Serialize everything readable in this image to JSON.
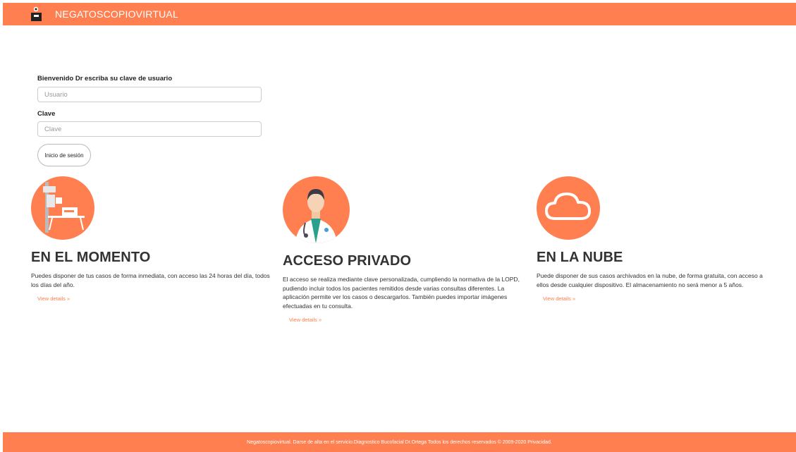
{
  "header": {
    "brand": "NEGATOSCOPIOVIRTUAL"
  },
  "login": {
    "welcome_label": "Bienvenido Dr escriba su clave de usuario",
    "user_placeholder": "Usuario",
    "password_label": "Clave",
    "password_placeholder": "Clave",
    "submit_label": "Inicio de sesión"
  },
  "features": [
    {
      "title": "EN EL MOMENTO",
      "text": "Puedes disponer de tus casos de forma inmediata, con acceso las 24 horas del día, todos los días del año.",
      "link": "View details »"
    },
    {
      "title": "ACCESO PRIVADO",
      "text": "El acceso se realiza mediante clave personalizada, cumpliendo la normativa de la LOPD, pudiendo incluir todos los pacientes remitidos desde varias consultas diferentes. La aplicación permite ver los casos o descargarlos. También puedes importar imágenes efectuadas en tu consulta.",
      "link": "View details »"
    },
    {
      "title": "EN LA NUBE",
      "text": "Puede disponer de sus casos archivados en la nube, de forma gratuita, con acceso a ellos desde cualquier dispositivo. El almacenamiento no será menor a 5 años.",
      "link": "View details »"
    }
  ],
  "footer": {
    "text": "Negatoscopiovirtual. Darse de alta en el servicio.Diagnostico Bucofacial Dr.Ortega Todos los derechos reservados © 2009-2020 Privacidad."
  },
  "colors": {
    "accent": "#ff7f50"
  },
  "icons": [
    "xray-machine-icon",
    "doctor-icon",
    "cloud-icon"
  ]
}
